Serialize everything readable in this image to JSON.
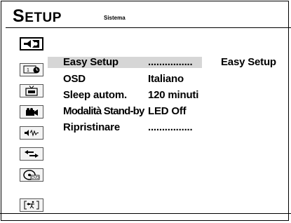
{
  "header": {
    "title_first": "S",
    "title_rest": "ETUP",
    "subtitle": "Sistema"
  },
  "sidebar": {
    "icons": [
      {
        "name": "speaker-icon",
        "selected": true
      },
      {
        "name": "clock-display-icon",
        "selected": false
      },
      {
        "name": "tv-icon",
        "selected": false
      },
      {
        "name": "camera-icon",
        "selected": false
      },
      {
        "name": "audio-icon",
        "selected": false
      },
      {
        "name": "arrows-icon",
        "selected": false
      },
      {
        "name": "dvd-icon",
        "selected": false
      },
      {
        "name": "exit-icon",
        "selected": false
      }
    ]
  },
  "menu": {
    "items": [
      {
        "label": "Easy Setup",
        "value": "................",
        "submenu": "Easy Setup"
      },
      {
        "label": "OSD",
        "value": "Italiano"
      },
      {
        "label": "Sleep autom.",
        "value": "120 minuti"
      },
      {
        "label": "Modalità Stand-by",
        "value": "LED Off"
      },
      {
        "label": "Ripristinare",
        "value": "................"
      }
    ]
  },
  "colors": {
    "highlight": "#d6d6d6",
    "border": "#000000",
    "background": "#ffffff"
  }
}
